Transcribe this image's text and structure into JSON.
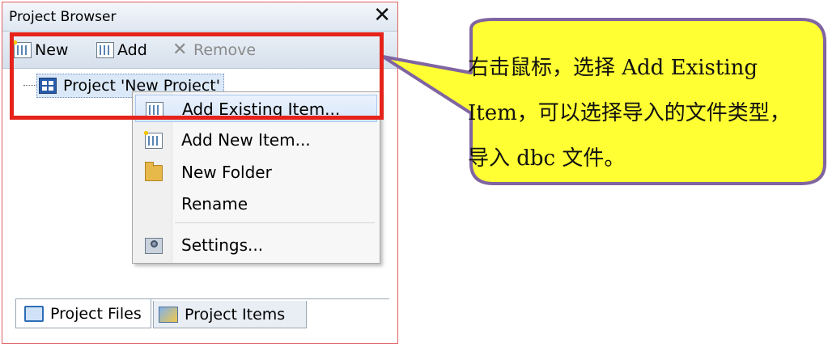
{
  "panel": {
    "title": "Project Browser",
    "close_glyph": "✕"
  },
  "toolbar": {
    "new_label": "New",
    "add_label": "Add",
    "remove_label": "Remove"
  },
  "tree": {
    "root_label": "Project 'New Project'"
  },
  "context_menu": {
    "items": [
      {
        "label": "Add Existing Item...",
        "icon": "grid-icon",
        "highlighted": true
      },
      {
        "label": "Add New Item...",
        "icon": "new-item-icon"
      },
      {
        "label": "New Folder",
        "icon": "folder-icon"
      },
      {
        "label": "Rename",
        "icon": ""
      },
      {
        "label": "Settings...",
        "icon": "settings-icon"
      }
    ]
  },
  "tabs": [
    {
      "label": "Project Files",
      "active": true,
      "icon": "project-files-icon"
    },
    {
      "label": "Project Items",
      "active": false,
      "icon": "project-items-icon"
    }
  ],
  "callout": {
    "text": "右击鼠标，选择 Add Existing Item，可以选择导入的文件类型，导入 dbc 文件。",
    "fill_color": "#ffff33",
    "border_color": "#8064a2"
  },
  "highlight_color": "#e5231b"
}
